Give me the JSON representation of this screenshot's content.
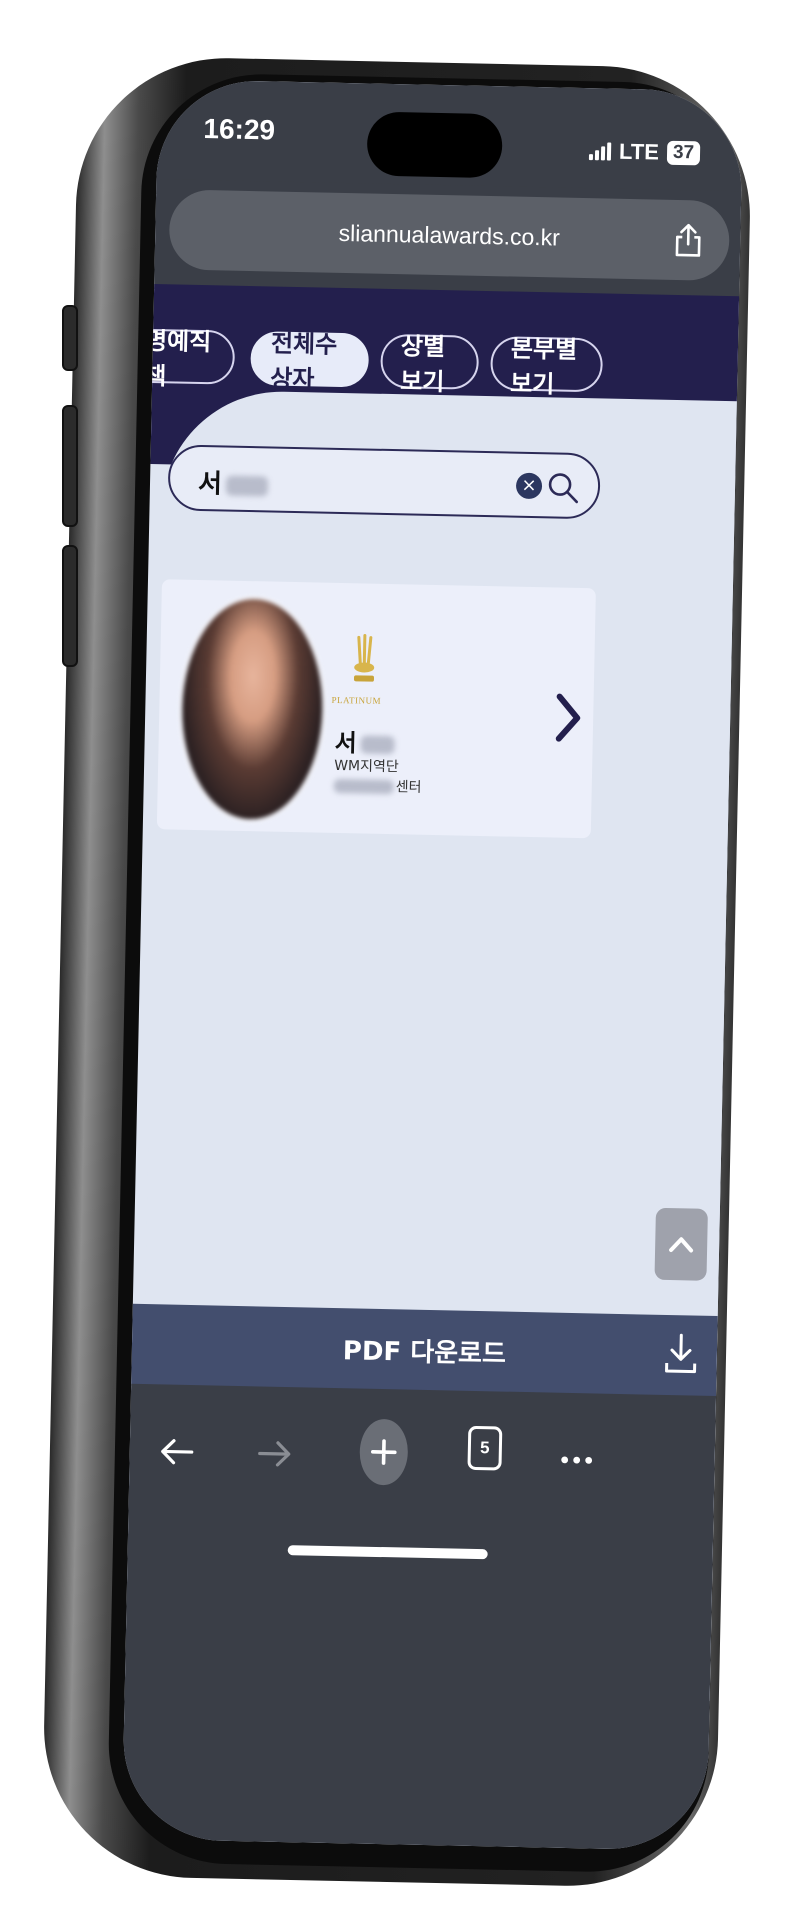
{
  "status_bar": {
    "time": "16:29",
    "network": "LTE",
    "battery": "37"
  },
  "browser": {
    "url": "sliannualawards.co.kr",
    "tab_count": "5"
  },
  "tabs": [
    {
      "label": "명예직책",
      "active": false
    },
    {
      "label": "전체수상자",
      "active": true
    },
    {
      "label": "상별보기",
      "active": false
    },
    {
      "label": "본부별보기",
      "active": false
    }
  ],
  "search": {
    "value": "서"
  },
  "result": {
    "badge_label": "PLATINUM",
    "name": "서",
    "division": "WM지역단",
    "center_suffix": "센터"
  },
  "footer": {
    "pdf_label": "PDF 다운로드"
  },
  "colors": {
    "header_bg": "#231f4d",
    "panel_bg": "#dfe5f1",
    "pdf_bar": "#434e6e",
    "gold": "#c8a43a"
  }
}
